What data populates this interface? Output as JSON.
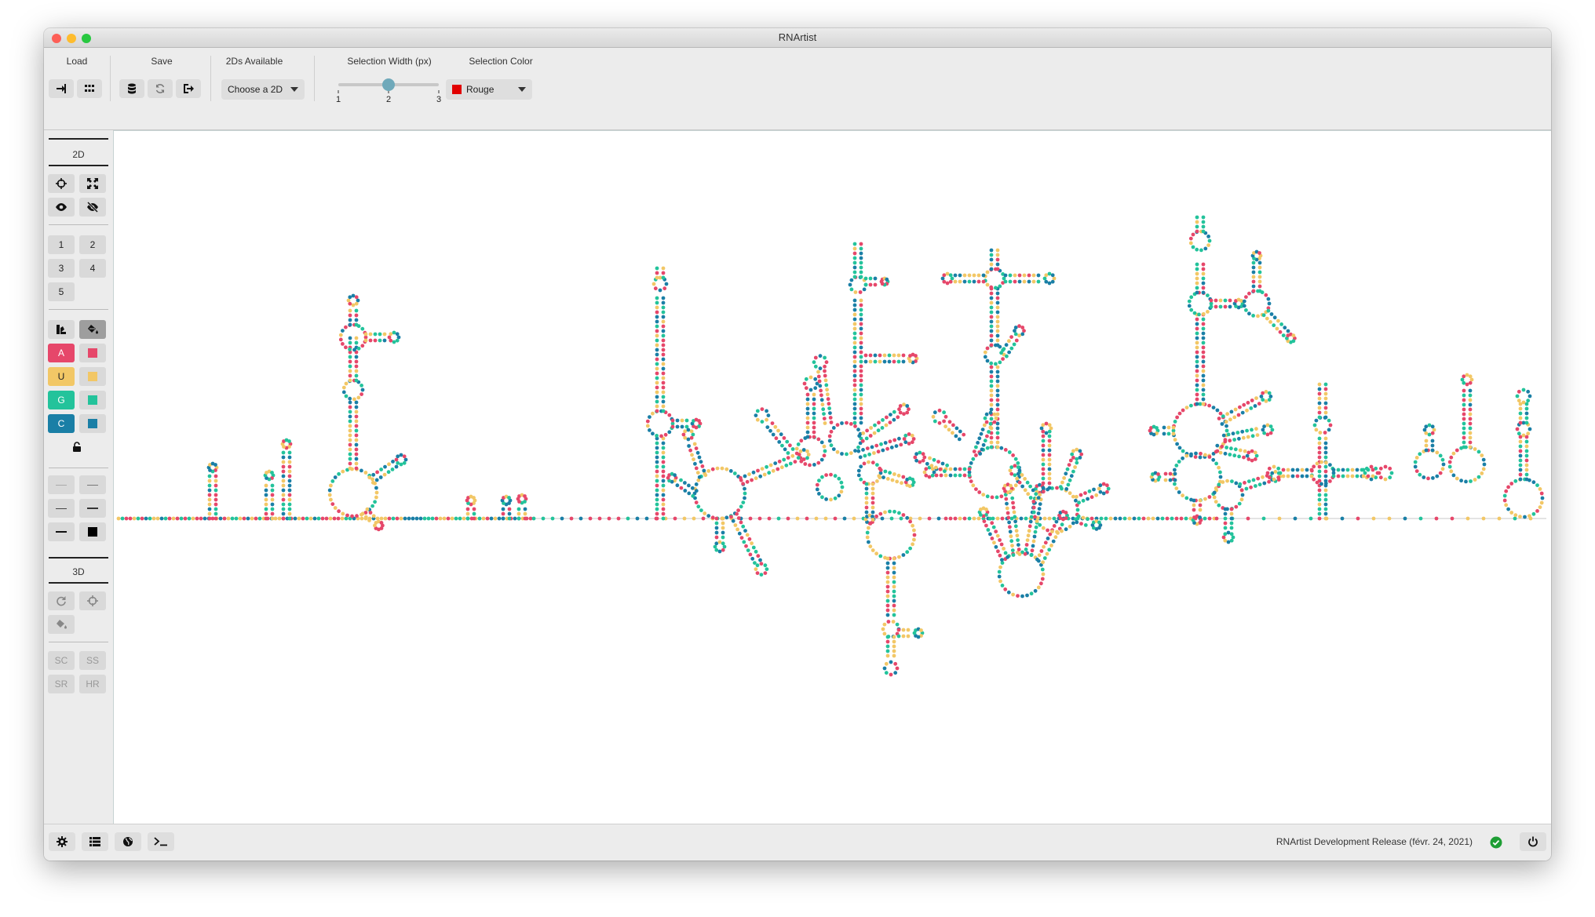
{
  "window": {
    "title": "RNArtist"
  },
  "toolbar": {
    "load_label": "Load",
    "save_label": "Save",
    "twods_label": "2Ds Available",
    "twods_select_value": "Choose a 2D",
    "selection_width_label": "Selection Width (px)",
    "selection_width_value": 2,
    "selection_width_min": 1,
    "selection_width_max": 3,
    "selection_width_ticks": [
      "1",
      "2",
      "3"
    ],
    "selection_color_label": "Selection Color",
    "selection_color_value": "Rouge",
    "selection_color_swatch": "#e10000"
  },
  "sidebar": {
    "section_2d": "2D",
    "numbers": [
      "1",
      "2",
      "3",
      "4",
      "5"
    ],
    "residues": [
      {
        "letter": "A",
        "color": "#e6476a"
      },
      {
        "letter": "U",
        "color": "#f2c766"
      },
      {
        "letter": "G",
        "color": "#23c39b"
      },
      {
        "letter": "C",
        "color": "#1a7fa6"
      }
    ],
    "section_3d": "3D",
    "bottom_buttons": [
      "SC",
      "SS",
      "SR",
      "HR"
    ]
  },
  "colors": {
    "A": "#e6476a",
    "U": "#f2c766",
    "G": "#23c39b",
    "C": "#1a7fa6"
  },
  "status": {
    "text": "RNArtist Development Release (févr. 24, 2021)"
  }
}
